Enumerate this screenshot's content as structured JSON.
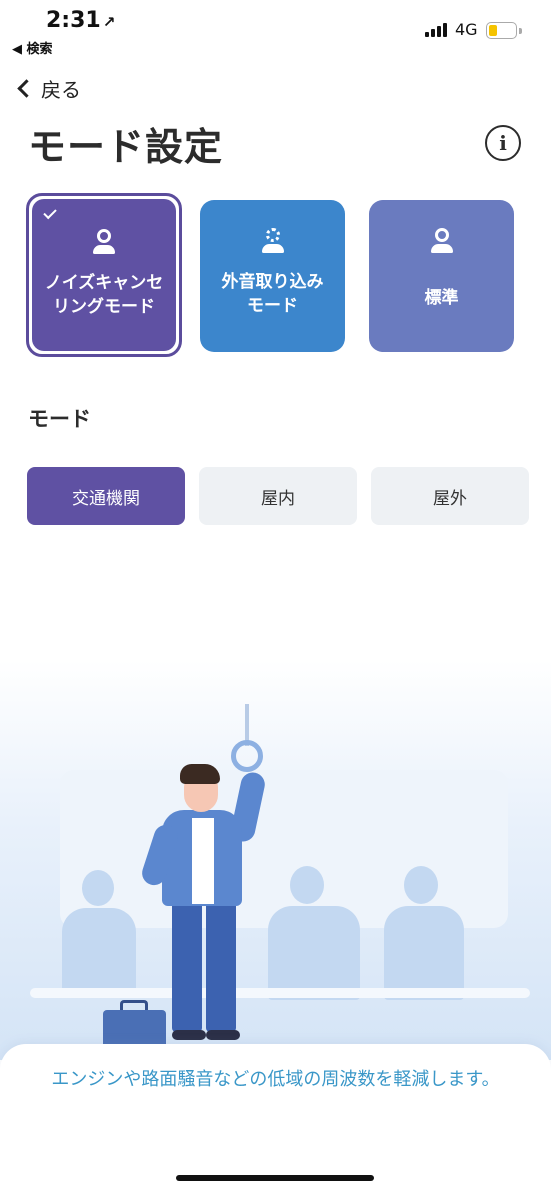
{
  "status_bar": {
    "time": "2:31",
    "location_arrow": "↗",
    "back_app": "◀ 検索",
    "network": "4G",
    "battery_level": 0.3
  },
  "nav": {
    "back_label": "戻る",
    "title": "モード設定",
    "info_icon": "i"
  },
  "mode_cards": [
    {
      "label": "ノイズキャンセリングモード",
      "line1": "ノイズキャンセ",
      "line2": "リングモード",
      "selected": true,
      "color": "#5f51a3",
      "icon": "person-icon"
    },
    {
      "label": "外音取り込みモード",
      "line1": "外音取り込み",
      "line2": "モード",
      "selected": false,
      "color": "#3c86cc",
      "icon": "person-dashed-icon"
    },
    {
      "label": "標準",
      "line1": "標準",
      "line2": "",
      "selected": false,
      "color": "#6a7bbf",
      "icon": "person-icon"
    }
  ],
  "mode_section": {
    "title": "モード",
    "options": [
      "交通機関",
      "屋内",
      "屋外"
    ],
    "selected_index": 0,
    "selected_color": "#5f51a3"
  },
  "description": "エンジンや路面騒音などの低域の周波数を軽減します。"
}
